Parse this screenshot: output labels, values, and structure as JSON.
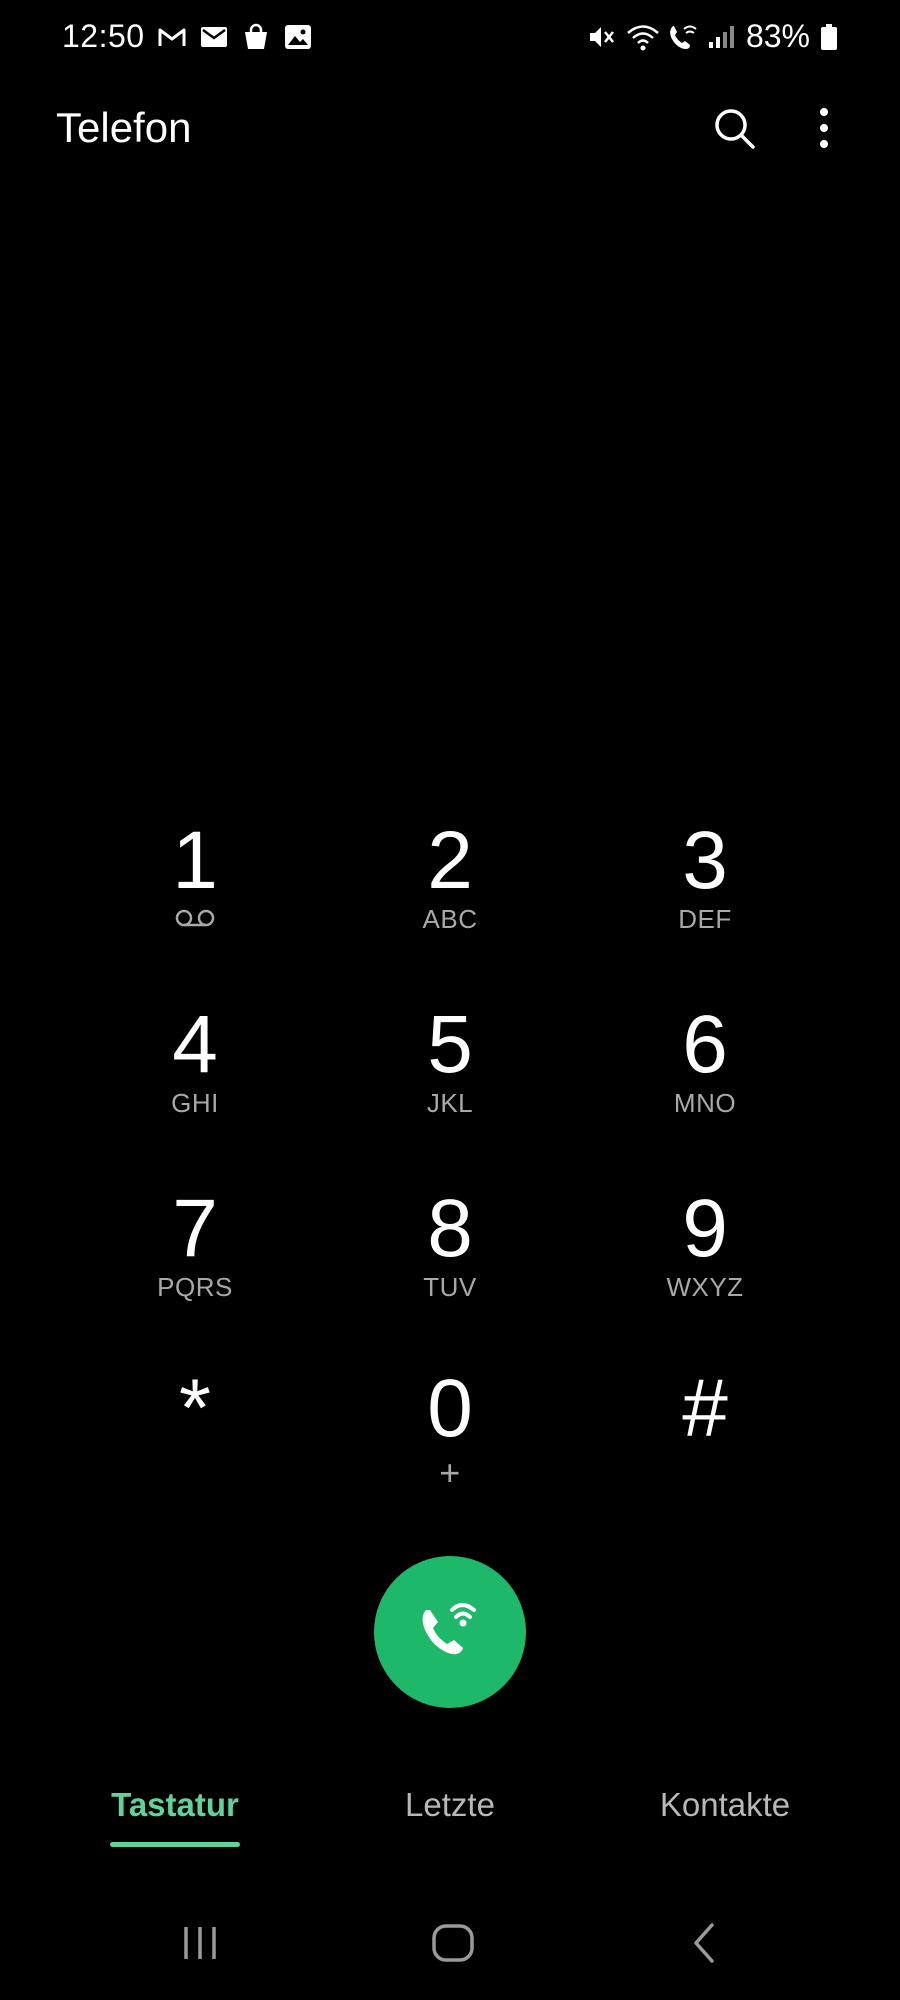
{
  "status_bar": {
    "time": "12:50",
    "left_icons": [
      "gmail-icon",
      "mail-icon",
      "shopping-bag-icon",
      "gallery-icon"
    ],
    "right_icons": [
      "mute-icon",
      "wifi-icon",
      "wifi-calling-icon",
      "signal-icon",
      "battery-icon"
    ],
    "battery_percent": "83%"
  },
  "header": {
    "title": "Telefon",
    "search_icon": "search-icon",
    "more_icon": "more-vertical-icon"
  },
  "dial": {
    "number": ""
  },
  "keypad": [
    {
      "digit": "1",
      "letters": "",
      "icon": "voicemail-icon"
    },
    {
      "digit": "2",
      "letters": "ABC"
    },
    {
      "digit": "3",
      "letters": "DEF"
    },
    {
      "digit": "4",
      "letters": "GHI"
    },
    {
      "digit": "5",
      "letters": "JKL"
    },
    {
      "digit": "6",
      "letters": "MNO"
    },
    {
      "digit": "7",
      "letters": "PQRS"
    },
    {
      "digit": "8",
      "letters": "TUV"
    },
    {
      "digit": "9",
      "letters": "WXYZ"
    },
    {
      "digit": "*",
      "letters": ""
    },
    {
      "digit": "0",
      "letters": "+"
    },
    {
      "digit": "#",
      "letters": ""
    }
  ],
  "call_button": {
    "icon": "wifi-call-icon",
    "color": "#1db86a"
  },
  "tabs": [
    {
      "label": "Tastatur",
      "active": true
    },
    {
      "label": "Letzte",
      "active": false
    },
    {
      "label": "Kontakte",
      "active": false
    }
  ],
  "colors": {
    "background": "#000000",
    "accent": "#5fd39a",
    "call_green": "#1db86a",
    "secondary_text": "#a8a8a8"
  },
  "nav_bar": {
    "recent_icon": "recent-apps-icon",
    "home_icon": "home-icon",
    "back_icon": "back-icon"
  }
}
